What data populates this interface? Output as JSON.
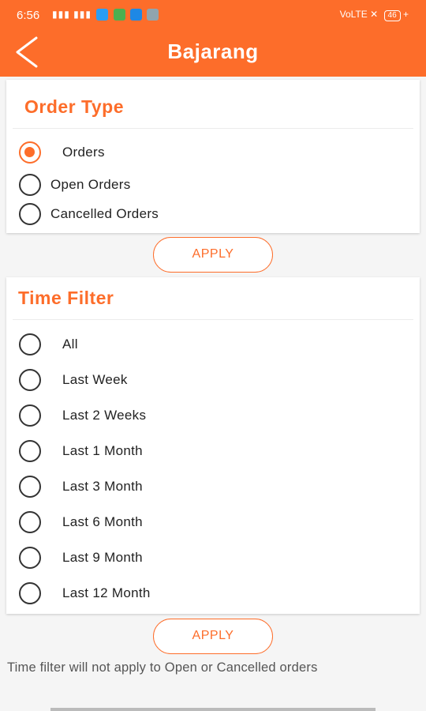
{
  "status_bar": {
    "time": "6:56",
    "battery": "46"
  },
  "header": {
    "title": "Bajarang"
  },
  "order_type": {
    "title": "Order Type",
    "options": [
      "Orders",
      "Open Orders",
      "Cancelled Orders"
    ],
    "selected_index": 0,
    "apply_label": "APPLY"
  },
  "time_filter": {
    "title": "Time Filter",
    "options": [
      "All",
      "Last Week",
      "Last 2 Weeks",
      "Last 1 Month",
      "Last 3 Month",
      "Last 6 Month",
      "Last 9 Month",
      "Last 12 Month"
    ],
    "selected_index": -1,
    "apply_label": "APPLY"
  },
  "note": "Time filter will not apply to Open or Cancelled orders",
  "colors": {
    "accent": "#fd6d2a",
    "background": "#f5f5f5"
  }
}
